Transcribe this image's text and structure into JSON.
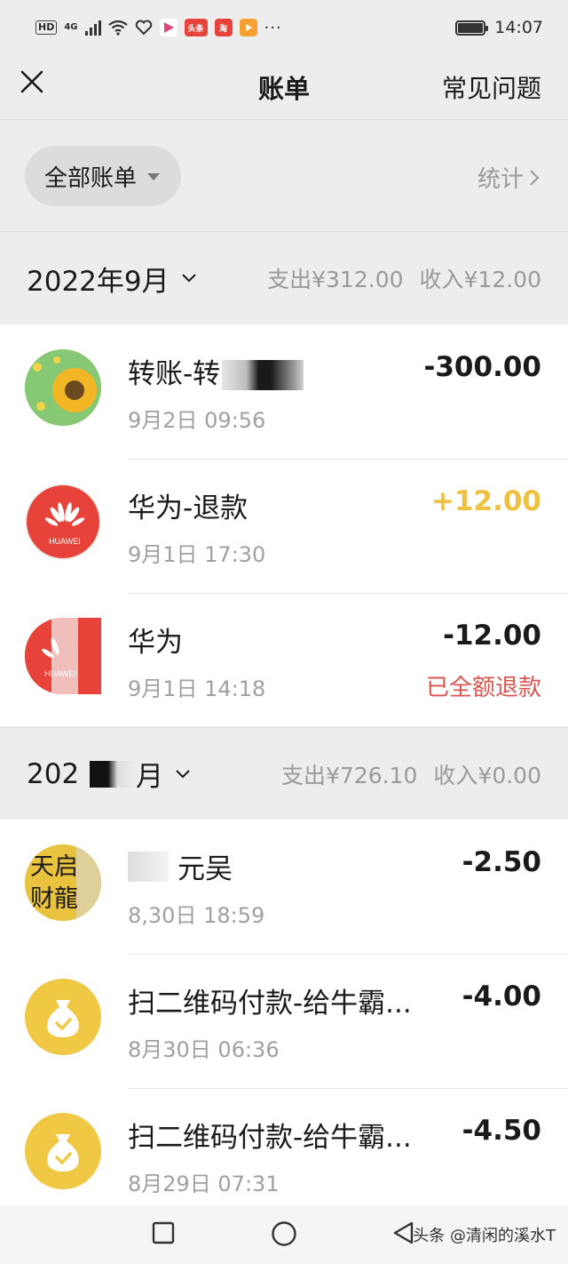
{
  "status_bar": {
    "hd": "HD",
    "network": "4G",
    "time": "14:07",
    "apps": [
      {
        "icon": "toutiao-app-icon",
        "text": "头条",
        "color": "#e8433a"
      },
      {
        "icon": "taobao-app-icon",
        "text": "淘",
        "color": "#e8433a"
      }
    ]
  },
  "nav": {
    "title": "账单",
    "help": "常见问题"
  },
  "filter": {
    "label": "全部账单",
    "stats": "统计"
  },
  "months": [
    {
      "label": "2022年9月",
      "expense": "支出¥312.00",
      "income": "收入¥12.00",
      "transactions": [
        {
          "title": "转账-转",
          "time": "9月2日 09:56",
          "amount": "-300.00",
          "avatar": "sunflower-avatar"
        },
        {
          "title": "华为-退款",
          "time": "9月1日 17:30",
          "amount": "+12.00",
          "avatar": "huawei-logo"
        },
        {
          "title": "华为",
          "time": "9月1日 14:18",
          "amount": "-12.00",
          "note": "已全额退款",
          "avatar": "huawei-logo"
        }
      ]
    },
    {
      "label": "202",
      "label_suffix": "月",
      "expense": "支出¥726.10",
      "income": "收入¥0.00",
      "transactions": [
        {
          "title": "元吴",
          "time": "8,30日 18:59",
          "amount": "-2.50",
          "avatar": "store-avatar",
          "avatar_text": "天启财龍"
        },
        {
          "title": "扫二维码付款-给牛霸...",
          "time": "8月30日 06:36",
          "amount": "-4.00",
          "avatar": "money-bag-icon"
        },
        {
          "title": "扫二维码付款-给牛霸...",
          "time": "8月29日 07:31",
          "amount": "-4.50",
          "avatar": "money-bag-icon"
        }
      ]
    }
  ],
  "huawei_text": "HUAWEI",
  "watermark": "头条 @清闲的溪水T",
  "colors": {
    "background": "#ededed",
    "income": "#f0c040",
    "refund": "#d9534f",
    "huawei": "#e8433a",
    "moneybag": "#f0c844"
  }
}
